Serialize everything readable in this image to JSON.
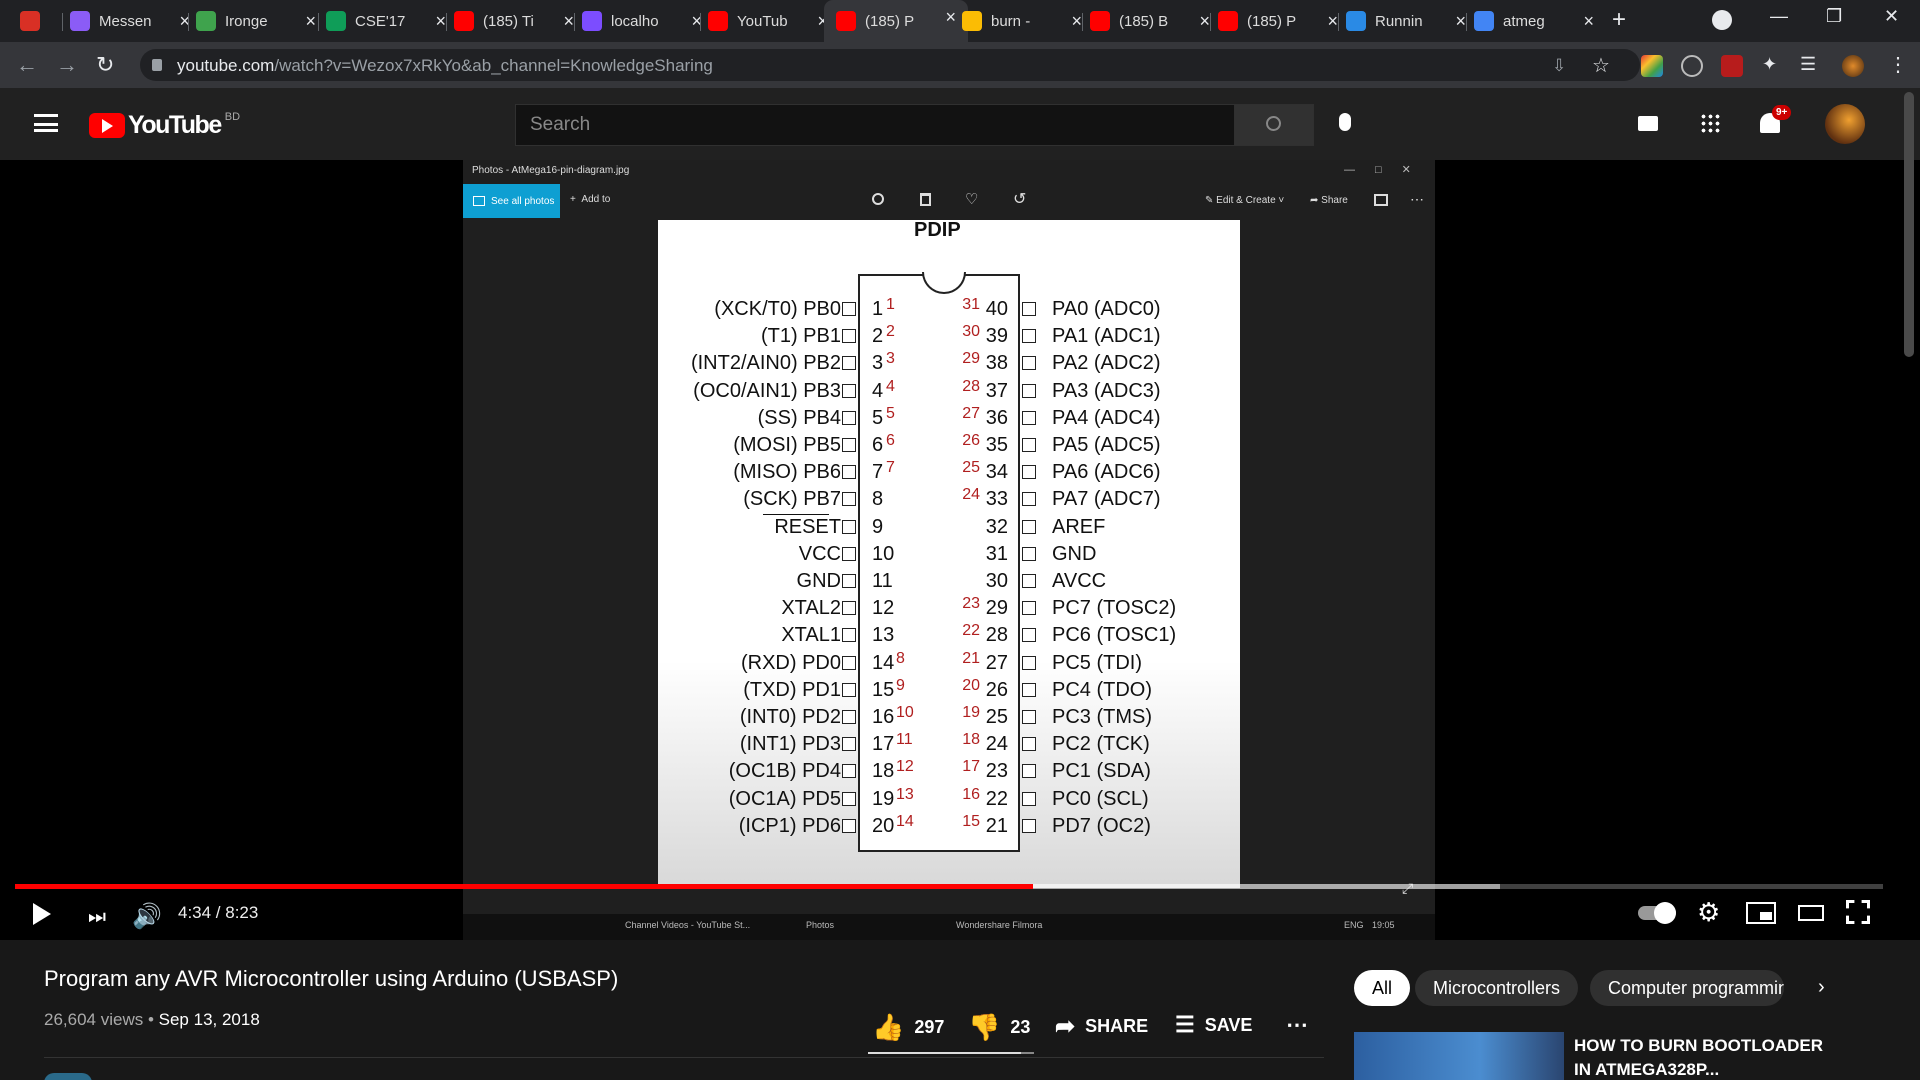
{
  "browser": {
    "tabs": [
      {
        "title": "",
        "icon": "gmail-icon",
        "color": "#d93025"
      },
      {
        "title": "Messen",
        "icon": "messenger-icon",
        "color": "#8b5cf6"
      },
      {
        "title": "Ironge",
        "icon": "ironge-icon",
        "color": "#3fa34d"
      },
      {
        "title": "CSE'17",
        "icon": "sheets-icon",
        "color": "#0f9d58"
      },
      {
        "title": "(185) Ti",
        "icon": "youtube-icon",
        "color": "#ff0000"
      },
      {
        "title": "localho",
        "icon": "localhost-icon",
        "color": "#7c4dff"
      },
      {
        "title": "YouTub",
        "icon": "youtube-icon",
        "color": "#ff0000"
      },
      {
        "title": "(185) P",
        "icon": "youtube-icon",
        "color": "#ff0000"
      },
      {
        "title": "burn - ",
        "icon": "drive-icon",
        "color": "#fbbc04"
      },
      {
        "title": "(185) B",
        "icon": "youtube-icon",
        "color": "#ff0000"
      },
      {
        "title": "(185) P",
        "icon": "youtube-icon",
        "color": "#ff0000"
      },
      {
        "title": "Runnin",
        "icon": "vscode-icon",
        "color": "#2a8ae5"
      },
      {
        "title": "atmeg",
        "icon": "google-icon",
        "color": "#4285f4"
      }
    ],
    "url_host": "youtube.com",
    "url_path": "/watch?v=Wezox7xRkYo&ab_channel=KnowledgeSharing"
  },
  "youtube": {
    "logo_text": "YouTube",
    "region": "BD",
    "search_placeholder": "Search",
    "notif_badge": "9+"
  },
  "photos": {
    "window_title": "Photos - AtMega16-pin-diagram.jpg",
    "see_all": "See all photos",
    "add_to": "Add to",
    "edit_create": "Edit & Create",
    "share": "Share"
  },
  "chip": {
    "package": "PDIP",
    "left": [
      {
        "label": "(XCK/T0)  PB0",
        "num": "1",
        "red": "1"
      },
      {
        "label": "(T1)  PB1",
        "num": "2",
        "red": "2"
      },
      {
        "label": "(INT2/AIN0)  PB2",
        "num": "3",
        "red": "3"
      },
      {
        "label": "(OC0/AIN1)  PB3",
        "num": "4",
        "red": "4"
      },
      {
        "label": "(SS)  PB4",
        "num": "5",
        "red": "5"
      },
      {
        "label": "(MOSI)  PB5",
        "num": "6",
        "red": "6"
      },
      {
        "label": "(MISO)  PB6",
        "num": "7",
        "red": "7"
      },
      {
        "label": "(SCK)  PB7",
        "num": "8",
        "red": ""
      },
      {
        "label": "RESET",
        "num": "9",
        "red": ""
      },
      {
        "label": "VCC",
        "num": "10",
        "red": ""
      },
      {
        "label": "GND",
        "num": "11",
        "red": ""
      },
      {
        "label": "XTAL2",
        "num": "12",
        "red": ""
      },
      {
        "label": "XTAL1",
        "num": "13",
        "red": ""
      },
      {
        "label": "(RXD)  PD0",
        "num": "14",
        "red": "8"
      },
      {
        "label": "(TXD)  PD1",
        "num": "15",
        "red": "9"
      },
      {
        "label": "(INT0)  PD2",
        "num": "16",
        "red": "10"
      },
      {
        "label": "(INT1)  PD3",
        "num": "17",
        "red": "11"
      },
      {
        "label": "(OC1B)  PD4",
        "num": "18",
        "red": "12"
      },
      {
        "label": "(OC1A)  PD5",
        "num": "19",
        "red": "13"
      },
      {
        "label": "(ICP1)  PD6",
        "num": "20",
        "red": "14"
      }
    ],
    "right": [
      {
        "label": "PA0  (ADC0)",
        "num": "40",
        "red": "31"
      },
      {
        "label": "PA1  (ADC1)",
        "num": "39",
        "red": "30"
      },
      {
        "label": "PA2  (ADC2)",
        "num": "38",
        "red": "29"
      },
      {
        "label": "PA3  (ADC3)",
        "num": "37",
        "red": "28"
      },
      {
        "label": "PA4  (ADC4)",
        "num": "36",
        "red": "27"
      },
      {
        "label": "PA5  (ADC5)",
        "num": "35",
        "red": "26"
      },
      {
        "label": "PA6  (ADC6)",
        "num": "34",
        "red": "25"
      },
      {
        "label": "PA7  (ADC7)",
        "num": "33",
        "red": "24"
      },
      {
        "label": "AREF",
        "num": "32",
        "red": ""
      },
      {
        "label": "GND",
        "num": "31",
        "red": ""
      },
      {
        "label": "AVCC",
        "num": "30",
        "red": ""
      },
      {
        "label": "PC7  (TOSC2)",
        "num": "29",
        "red": "23"
      },
      {
        "label": "PC6  (TOSC1)",
        "num": "28",
        "red": "22"
      },
      {
        "label": "PC5  (TDI)",
        "num": "27",
        "red": "21"
      },
      {
        "label": "PC4  (TDO)",
        "num": "26",
        "red": "20"
      },
      {
        "label": "PC3  (TMS)",
        "num": "25",
        "red": "19"
      },
      {
        "label": "PC2  (TCK)",
        "num": "24",
        "red": "18"
      },
      {
        "label": "PC1  (SDA)",
        "num": "23",
        "red": "17"
      },
      {
        "label": "PC0  (SCL)",
        "num": "22",
        "red": "16"
      },
      {
        "label": "PD7  (OC2)",
        "num": "21",
        "red": "15"
      }
    ]
  },
  "taskbar": {
    "items": [
      "Channel Videos - YouTube St...",
      "Photos",
      "Wondershare Filmora"
    ],
    "lang": "ENG",
    "time": "19:05"
  },
  "player": {
    "time": "4:34 / 8:23",
    "progress": 0.545,
    "loaded": 0.795
  },
  "video": {
    "title": "Program any AVR Microcontroller using Arduino (USBASP)",
    "views": "26,604 views",
    "date": "Sep 13, 2018",
    "likes": "297",
    "dislikes": "23",
    "share": "SHARE",
    "save": "SAVE"
  },
  "chips_nav": [
    "All",
    "Microcontrollers",
    "Computer programmin"
  ],
  "related": {
    "title_line1": "HOW TO BURN BOOTLOADER",
    "title_line2": "IN ATMEGA328P..."
  }
}
